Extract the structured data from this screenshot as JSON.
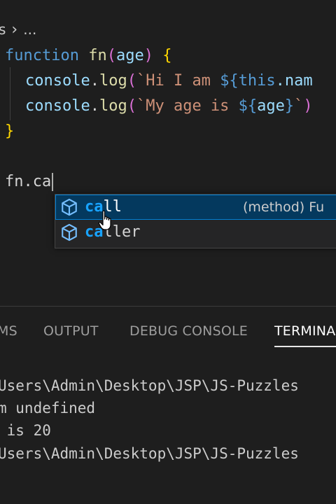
{
  "breadcrumb": {
    "segment": "s",
    "ellipsis": "..."
  },
  "editor": {
    "lines": [
      {
        "kw": "function",
        "name": "fn",
        "open": "(",
        "param": "age",
        "close": ")",
        "brace": "{"
      },
      {
        "obj": "console",
        "dot": ".",
        "method": "log",
        "paren": "(",
        "str1": "`Hi I am ",
        "interp_open": "${",
        "this": "this",
        "rest": ".nam"
      },
      {
        "obj": "console",
        "dot": ".",
        "method": "log",
        "paren": "(",
        "str1": "`My age is ",
        "interp_open": "${",
        "var": "age",
        "interp_close": "}",
        "tick": "`",
        "paren_close": ")"
      },
      {
        "brace": "}"
      },
      {
        "text": "fn.ca"
      }
    ]
  },
  "suggest": {
    "items": [
      {
        "match": "ca",
        "rest": "ll",
        "detail": "(method) Fu",
        "icon": "method-cube-icon"
      },
      {
        "match": "ca",
        "rest": "ller",
        "icon": "method-cube-icon"
      }
    ]
  },
  "panel": {
    "tabs": [
      {
        "label": "MS"
      },
      {
        "label": "OUTPUT"
      },
      {
        "label": "DEBUG CONSOLE"
      },
      {
        "label": "TERMINAL"
      }
    ],
    "terminal_lines": [
      "Users\\Admin\\Desktop\\JSP\\JS-Puzzles",
      "m undefined",
      " is 20",
      "Users\\Admin\\Desktop\\JSP\\JS-Puzzles"
    ]
  },
  "colors": {
    "background": "#1e1e1e",
    "keyword": "#569cd6",
    "function": "#dcdcaa",
    "string": "#ce9178",
    "match_highlight": "#18a3ff",
    "selection": "#04395e"
  }
}
